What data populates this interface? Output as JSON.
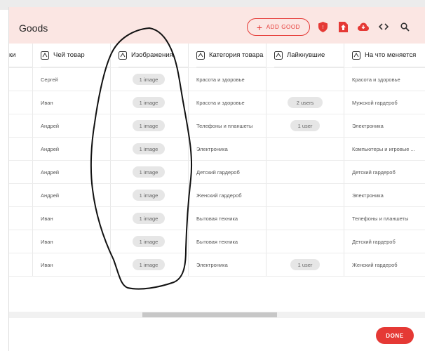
{
  "header": {
    "title": "Goods",
    "add_button": "ADD GOOD",
    "icons": [
      "shield-icon",
      "upload-icon",
      "cloud-download-icon",
      "code-icon",
      "search-icon"
    ]
  },
  "table": {
    "columns": [
      "ки",
      "Чей товар",
      "Изображения",
      "Категория товара",
      "Лайкнувшие",
      "На что меняется"
    ],
    "rows": [
      {
        "owner": "Сергей",
        "images": "1 image",
        "category": "Красота и здоровье",
        "likes": "",
        "exchange": "Красота и здоровье"
      },
      {
        "owner": "Иван",
        "images": "1 image",
        "category": "Красота и здоровье",
        "likes": "2 users",
        "exchange": "Мужской гардероб"
      },
      {
        "owner": "Андрей",
        "images": "1 image",
        "category": "Телефоны и планшеты",
        "likes": "1 user",
        "exchange": "Электроника"
      },
      {
        "owner": "Андрей",
        "images": "1 image",
        "category": "Электроника",
        "likes": "",
        "exchange": "Компьютеры и игровые ..."
      },
      {
        "owner": "Андрей",
        "images": "1 image",
        "category": "Детский гардероб",
        "likes": "",
        "exchange": "Детский гардероб"
      },
      {
        "owner": "Андрей",
        "images": "1 image",
        "category": "Женский гардероб",
        "likes": "",
        "exchange": "Электроника"
      },
      {
        "owner": "Иван",
        "images": "1 image",
        "category": "Бытовая техника",
        "likes": "",
        "exchange": "Телефоны и планшеты"
      },
      {
        "owner": "Иван",
        "images": "1 image",
        "category": "Бытовая техника",
        "likes": "",
        "exchange": "Детский гардероб"
      },
      {
        "owner": "Иван",
        "images": "1 image",
        "category": "Электроника",
        "likes": "1 user",
        "exchange": "Женский гардероб"
      }
    ]
  },
  "footer": {
    "done_button": "DONE"
  },
  "colors": {
    "accent": "#e53935",
    "header_bg": "#fbe6e3"
  }
}
